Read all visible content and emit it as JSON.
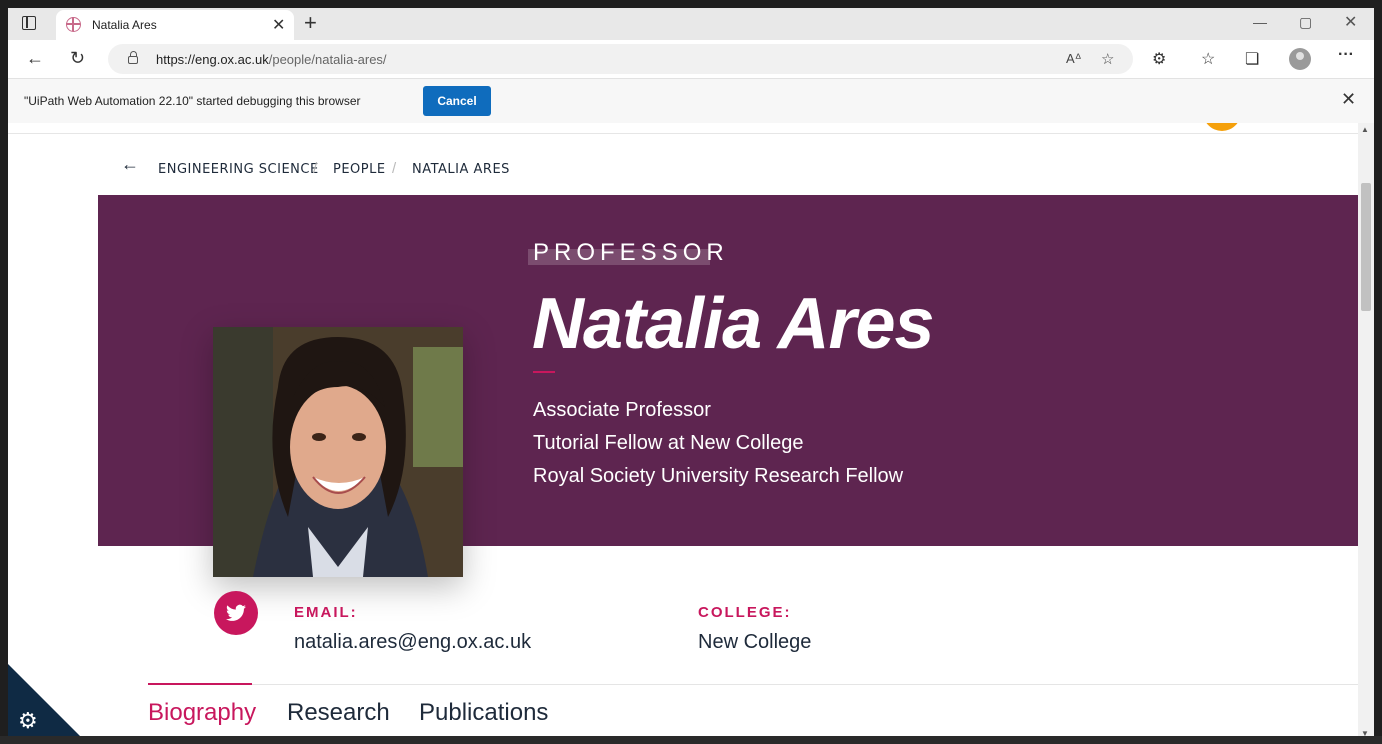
{
  "browser": {
    "tab_title": "Natalia Ares",
    "url_host": "https://eng.ox.ac.uk",
    "url_path": "/people/natalia-ares/",
    "infobar_text": "\"UiPath Web Automation 22.10\" started debugging this browser",
    "infobar_button": "Cancel"
  },
  "breadcrumb": {
    "items": [
      "ENGINEERING SCIENCE",
      "PEOPLE",
      "NATALIA ARES"
    ],
    "separator": "/"
  },
  "profile": {
    "rank": "PROFESSOR",
    "name": "Natalia Ares",
    "roles": [
      "Associate Professor",
      "Tutorial Fellow at New College",
      "Royal Society University Research Fellow"
    ],
    "email_label": "EMAIL:",
    "email": "natalia.ares@eng.ox.ac.uk",
    "college_label": "COLLEGE:",
    "college": "New College"
  },
  "page_tabs": [
    "Biography",
    "Research",
    "Publications"
  ],
  "colors": {
    "hero_bg": "#5e2550",
    "accent": "#c8175d",
    "text_dark": "#1e2a3a",
    "edge_button": "#0f6cbd"
  },
  "icons": [
    "back-arrow-icon",
    "refresh-icon",
    "lock-icon",
    "read-aloud-icon",
    "favorite-add-icon",
    "extensions-icon",
    "favorites-icon",
    "collections-icon",
    "profile-icon",
    "more-icon",
    "twitter-icon",
    "cookie-settings-icon"
  ]
}
